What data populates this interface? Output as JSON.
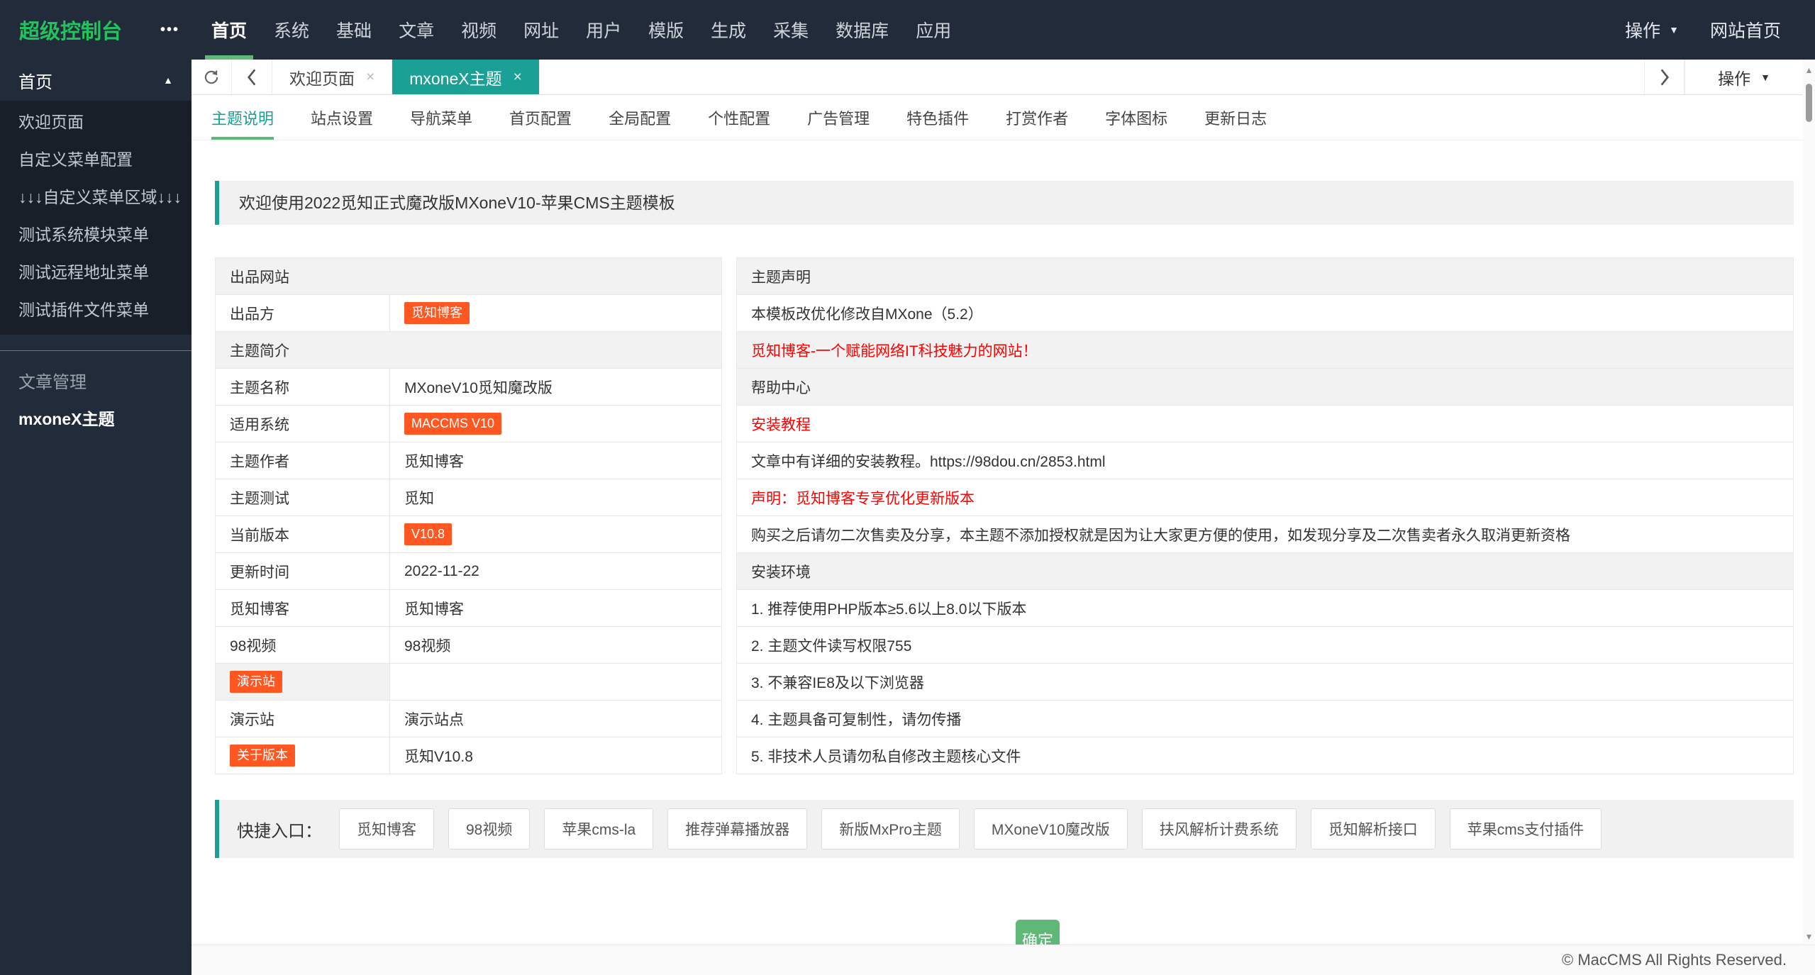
{
  "topbar": {
    "brand": "超级控制台",
    "nav": [
      {
        "label": "首页"
      },
      {
        "label": "系统"
      },
      {
        "label": "基础"
      },
      {
        "label": "文章"
      },
      {
        "label": "视频"
      },
      {
        "label": "网址"
      },
      {
        "label": "用户"
      },
      {
        "label": "模版"
      },
      {
        "label": "生成"
      },
      {
        "label": "采集"
      },
      {
        "label": "数据库"
      },
      {
        "label": "应用"
      }
    ],
    "action_label": "操作",
    "site_home_label": "网站首页"
  },
  "sidebar": {
    "home_section": "首页",
    "home_items": [
      "欢迎页面",
      "自定义菜单配置",
      "↓↓↓自定义菜单区域↓↓↓",
      "测试系统模块菜单",
      "测试远程地址菜单",
      "测试插件文件菜单"
    ],
    "article_section": "文章管理",
    "theme_item": "mxoneX主题"
  },
  "tabbar": {
    "tabs": [
      {
        "label": "欢迎页面"
      },
      {
        "label": "mxoneX主题"
      }
    ],
    "action_label": "操作"
  },
  "subtabs": {
    "items": [
      "主题说明",
      "站点设置",
      "导航菜单",
      "首页配置",
      "全局配置",
      "个性配置",
      "广告管理",
      "特色插件",
      "打赏作者",
      "字体图标",
      "更新日志"
    ]
  },
  "alert": {
    "text": "欢迎使用2022觅知正式魔改版MXoneV10-苹果CMS主题模板"
  },
  "info_table": {
    "rows": [
      {
        "label": "出品网站"
      },
      {
        "label": "出品方",
        "value": "觅知博客"
      },
      {
        "label": "主题简介"
      },
      {
        "label": "主题名称",
        "value": "MXoneV10觅知魔改版"
      },
      {
        "label": "适用系统",
        "value": "MACCMS V10"
      },
      {
        "label": "主题作者",
        "value": "觅知博客"
      },
      {
        "label": "主题测试",
        "value": "觅知"
      },
      {
        "label": "当前版本",
        "value": "V10.8"
      },
      {
        "label": "更新时间",
        "value": "2022-11-22"
      },
      {
        "label": "觅知博客",
        "value": "觅知博客"
      },
      {
        "label": "98视频",
        "value": "98视频"
      },
      {
        "label": "演示站",
        "value": ""
      },
      {
        "label": "演示站",
        "value": "演示站点"
      },
      {
        "label": "关于版本",
        "value": "觅知V10.8"
      }
    ]
  },
  "notes_table": {
    "rows": [
      {
        "text": "主题声明"
      },
      {
        "text": "本模板改优化修改自MXone（5.2）"
      },
      {
        "text": "觅知博客-一个赋能网络IT科技魅力的网站！"
      },
      {
        "text": "帮助中心"
      },
      {
        "text": "安装教程"
      },
      {
        "text": "文章中有详细的安装教程。https://98dou.cn/2853.html"
      },
      {
        "text": "声明：觅知博客专享优化更新版本"
      },
      {
        "text": "购买之后请勿二次售卖及分享，本主题不添加授权就是因为让大家更方便的使用，如发现分享及二次售卖者永久取消更新资格"
      },
      {
        "text": "安装环境"
      },
      {
        "text": "1. 推荐使用PHP版本≥5.6以上8.0以下版本"
      },
      {
        "text": "2. 主题文件读写权限755"
      },
      {
        "text": "3. 不兼容IE8及以下浏览器"
      },
      {
        "text": "4. 主题具备可复制性，请勿传播"
      },
      {
        "text": "5. 非技术人员请勿私自修改主题核心文件"
      }
    ]
  },
  "quick_links": {
    "label": "快捷入口：",
    "buttons": [
      "觅知博客",
      "98视频",
      "苹果cms-la",
      "推荐弹幕播放器",
      "新版MxPro主题",
      "MXoneV10魔改版",
      "扶风解析计费系统",
      "觅知解析接口",
      "苹果cms支付插件"
    ]
  },
  "confirm_label": "确定",
  "footer": {
    "copyright": "© MacCMS All Rights Reserved."
  },
  "icons": {
    "ellipsis": "•••",
    "caret_down": "▼",
    "caret_up": "▲",
    "close": "×",
    "scroll_up": "▲",
    "scroll_down": "▼"
  },
  "colors": {
    "accent_teal": "#1aa094",
    "accent_green": "#5FB878",
    "brand_green": "#22c35e",
    "badge_orange": "#FF5722",
    "alert_red": "#ff0000",
    "dark": "#222b3a"
  }
}
